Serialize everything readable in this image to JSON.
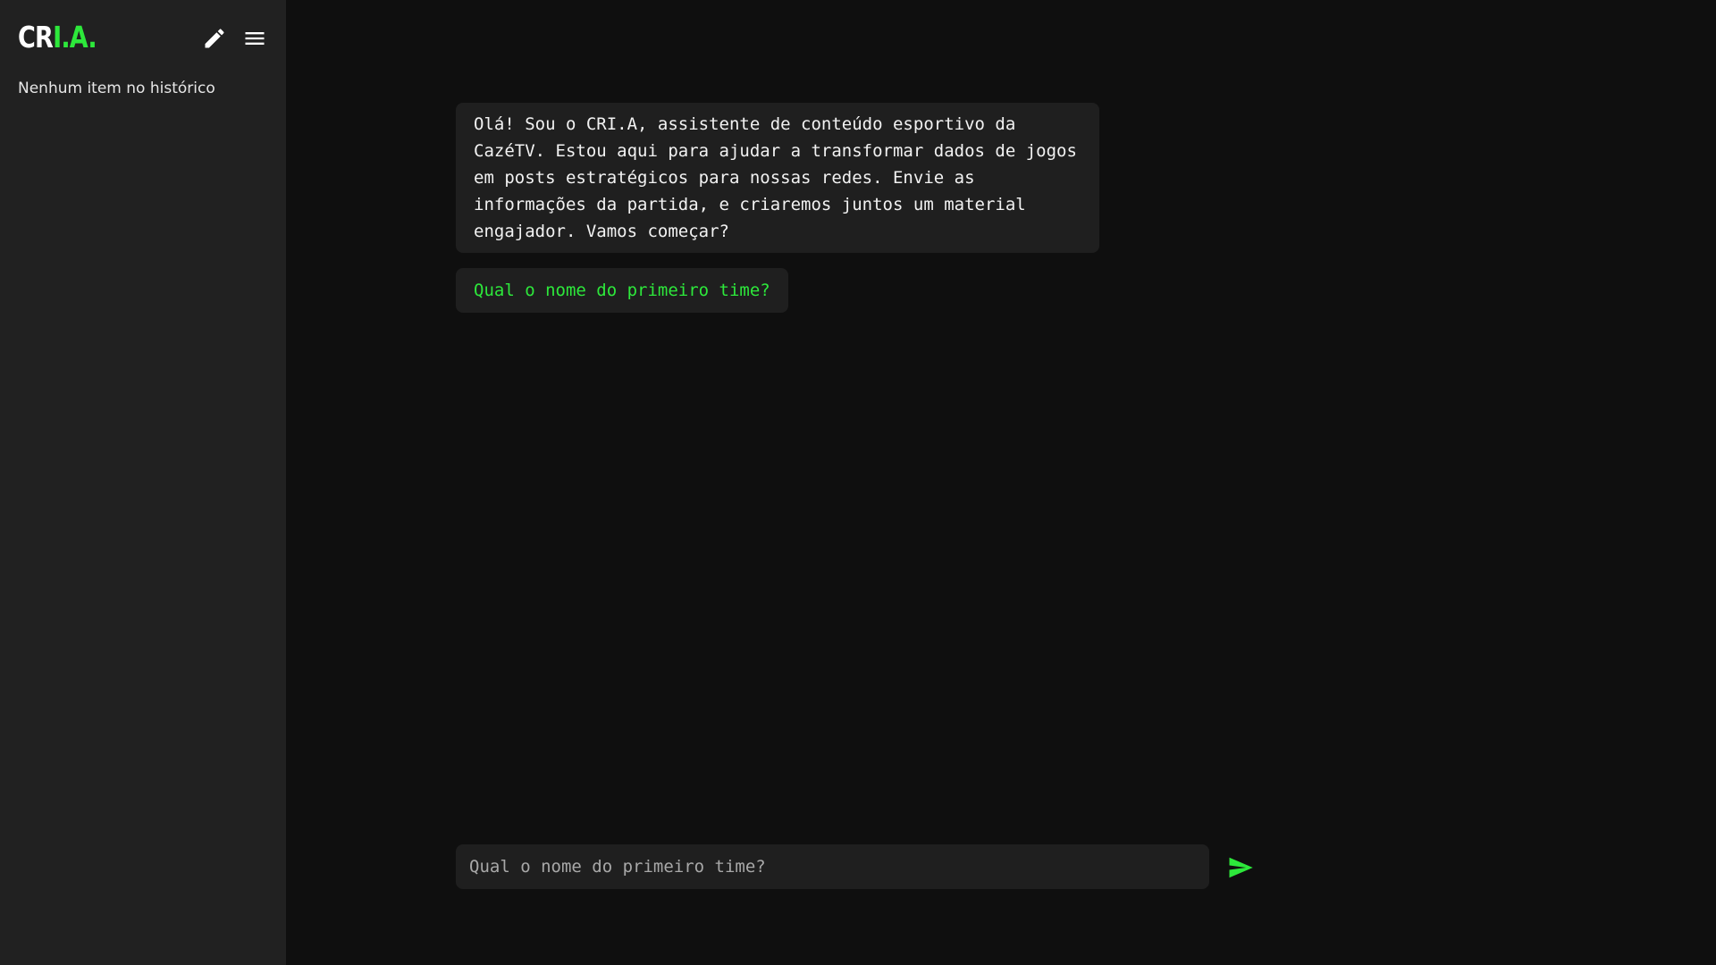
{
  "sidebar": {
    "logo": {
      "part1": "CR",
      "part2": "I.A."
    },
    "edit_icon": "pencil-icon",
    "menu_icon": "hamburger-menu-icon",
    "history_empty": "Nenhum item no histórico"
  },
  "chat": {
    "messages": [
      {
        "role": "assistant",
        "text": "Olá! Sou o CRI.A, assistente de conteúdo esportivo da CazéTV. Estou aqui para ajudar a transformar dados de jogos em posts estratégicos para nossas redes. Envie as informações da partida, e criaremos juntos um material engajador. Vamos começar?"
      },
      {
        "role": "assistant-question",
        "text": "Qual o nome do primeiro time?"
      }
    ],
    "input": {
      "value": "",
      "placeholder": "Qual o nome do primeiro time?"
    },
    "send_icon": "send-icon"
  },
  "colors": {
    "background": "#0f0f0f",
    "sidebar": "#212121",
    "bubble": "#1f1f1f",
    "accent": "#2de83b",
    "text": "#f2f2f2"
  }
}
